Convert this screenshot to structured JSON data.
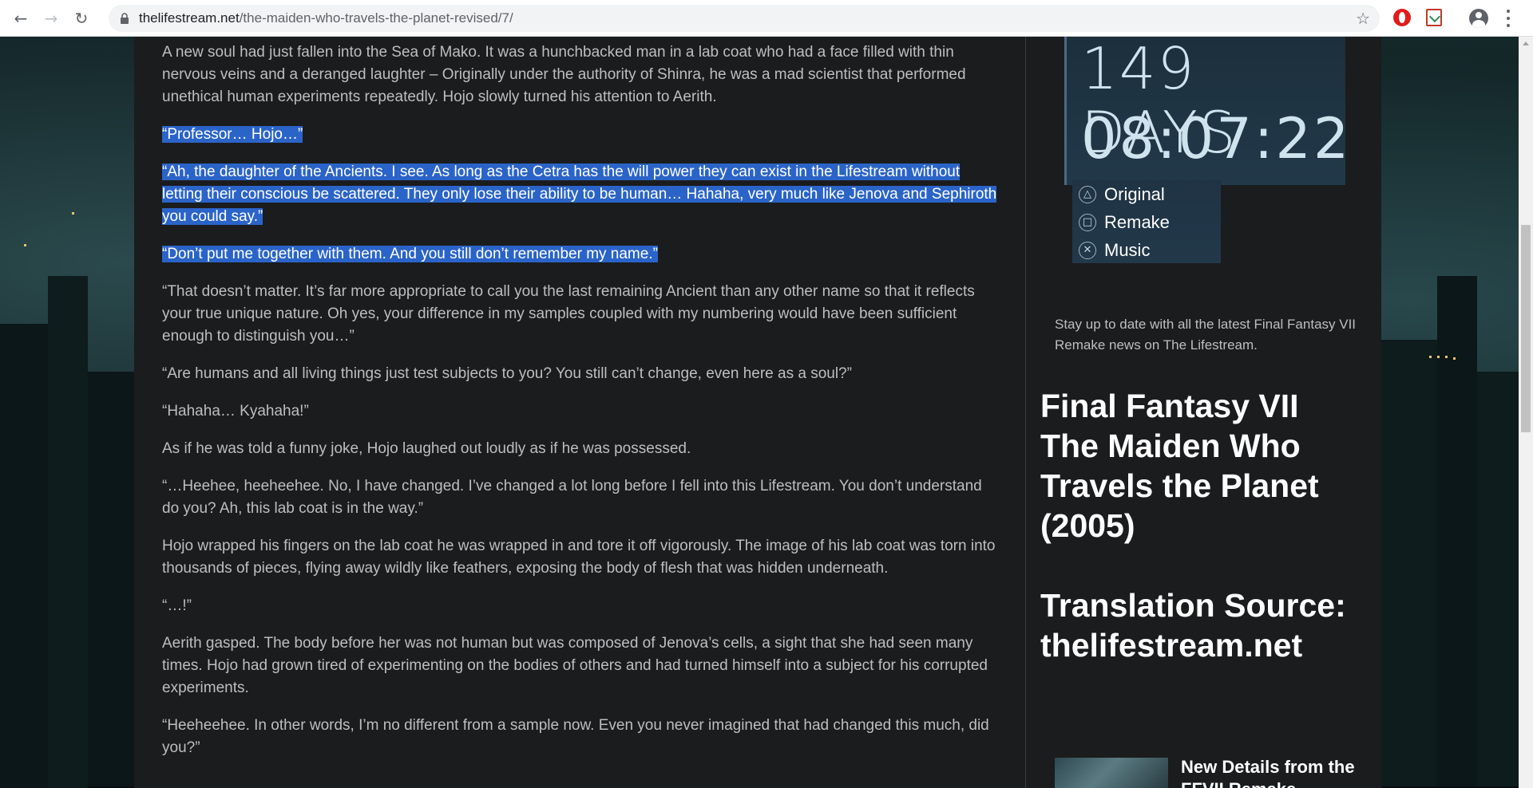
{
  "browser": {
    "url_host": "thelifestream.net",
    "url_path": "/the-maiden-who-travels-the-planet-revised/7/"
  },
  "article": {
    "paragraphs": [
      {
        "text": "A new soul had just fallen into the Sea of Mako. It was a hunchbacked man in a lab coat who had a face filled with thin nervous veins and a deranged laughter – Originally under the authority of Shinra, he was a mad scientist that performed unethical human experiments repeatedly. Hojo slowly turned his attention to Aerith.",
        "highlighted": false
      },
      {
        "text": "“Professor… Hojo…”",
        "highlighted": true
      },
      {
        "text": "“Ah, the daughter of the Ancients. I see. As long as the Cetra has the will power they can exist in the Lifestream without letting their conscious be scattered. They only lose their ability to be human… Hahaha, very much like Jenova and Sephiroth you could say.”",
        "highlighted": true
      },
      {
        "text": "“Don’t put me together with them. And you still don’t remember my name.”",
        "highlighted": true
      },
      {
        "text": "“That doesn’t matter. It’s far more appropriate to call you the last remaining Ancient than any other name so that it reflects your true unique nature. Oh yes, your difference in my samples coupled with my numbering would have been sufficient enough to distinguish you…”",
        "highlighted": false
      },
      {
        "text": "“Are humans and all living things just test subjects to you? You still can’t change, even here as a soul?”",
        "highlighted": false
      },
      {
        "text": "“Hahaha… Kyahaha!”",
        "highlighted": false
      },
      {
        "text": "As if he was told a funny joke, Hojo laughed out loudly as if he was possessed.",
        "highlighted": false
      },
      {
        "text": "“…Heehee, heeheehee. No, I have changed. I’ve changed a lot long before I fell into this Lifestream. You don’t understand do you? Ah, this lab coat is in the way.”",
        "highlighted": false
      },
      {
        "text": "Hojo wrapped his fingers on the lab coat he was wrapped in and tore it off vigorously. The image of his lab coat was torn into thousands of pieces, flying away wildly like feathers, exposing the body of flesh that was hidden underneath.",
        "highlighted": false
      },
      {
        "text": "“…!”",
        "highlighted": false
      },
      {
        "text": "Aerith gasped. The body before her was not human but was composed of Jenova’s cells, a sight that she had seen many times. Hojo had grown tired of experimenting on the bodies of others and had turned himself into a subject for his corrupted experiments.",
        "highlighted": false
      },
      {
        "text": "“Heeheehee. In other words, I’m no different from a sample now. Even you never imagined that had changed this much, did you?”",
        "highlighted": false
      }
    ]
  },
  "sidebar": {
    "countdown": {
      "days": "149 DAYS",
      "time": "08:07:22",
      "menu": [
        {
          "label": "Original",
          "icon": "triangle-icon",
          "glyph": "△"
        },
        {
          "label": "Remake",
          "icon": "square-icon",
          "glyph": "□"
        },
        {
          "label": "Music",
          "icon": "cross-icon",
          "glyph": "✕"
        }
      ]
    },
    "news_blurb": "Stay up to date with all the latest Final Fantasy VII Remake news on The Lifestream.",
    "promo_lines_1": [
      "Final Fantasy VII",
      "The Maiden Who",
      "Travels the Planet",
      "(2005)"
    ],
    "promo_lines_2": [
      "Translation Source:",
      "thelifestream.net"
    ],
    "news_item_title": "New Details from the FFVII Remake"
  },
  "colors": {
    "highlight": "#2b64c8",
    "article_bg": "#1b1c1e",
    "text": "#bdbec0"
  }
}
